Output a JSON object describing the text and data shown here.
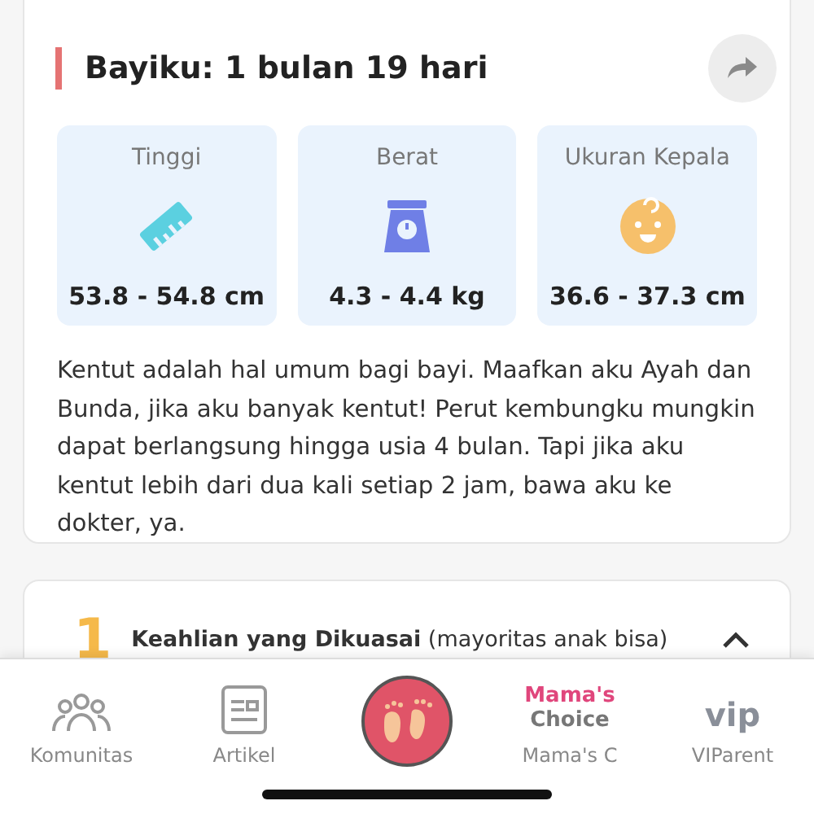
{
  "card": {
    "title": "Bayiku: 1 bulan 19 hari",
    "metrics": [
      {
        "kind": "ruler",
        "label": "Tinggi",
        "value": "53.8 - 54.8 cm"
      },
      {
        "kind": "scale",
        "label": "Berat",
        "value": "4.3 - 4.4 kg"
      },
      {
        "kind": "head",
        "label": "Ukuran Kepala",
        "value": "36.6 - 37.3 cm"
      }
    ],
    "description": "Kentut adalah hal umum bagi bayi. Maafkan aku Ayah dan Bunda, jika aku banyak kentut! Perut kembungku mungkin dapat berlangsung hingga usia 4 bulan. Tapi jika aku kentut lebih dari dua kali setiap 2 jam, bawa aku ke dokter, ya."
  },
  "skills": {
    "number": "1",
    "title": "**Keahlian yang Dikuasai** (mayoritas anak bisa)",
    "expanded": true
  },
  "nav": [
    {
      "kind": "community",
      "label": "Komunitas"
    },
    {
      "kind": "article",
      "label": "Artikel"
    },
    {
      "kind": "center"
    },
    {
      "kind": "mamas-choice",
      "logo": [
        "Mama's",
        "Choice"
      ],
      "label": "Mama's C"
    },
    {
      "kind": "vip",
      "logo": [
        "vip"
      ],
      "label": "VIParent"
    }
  ]
}
